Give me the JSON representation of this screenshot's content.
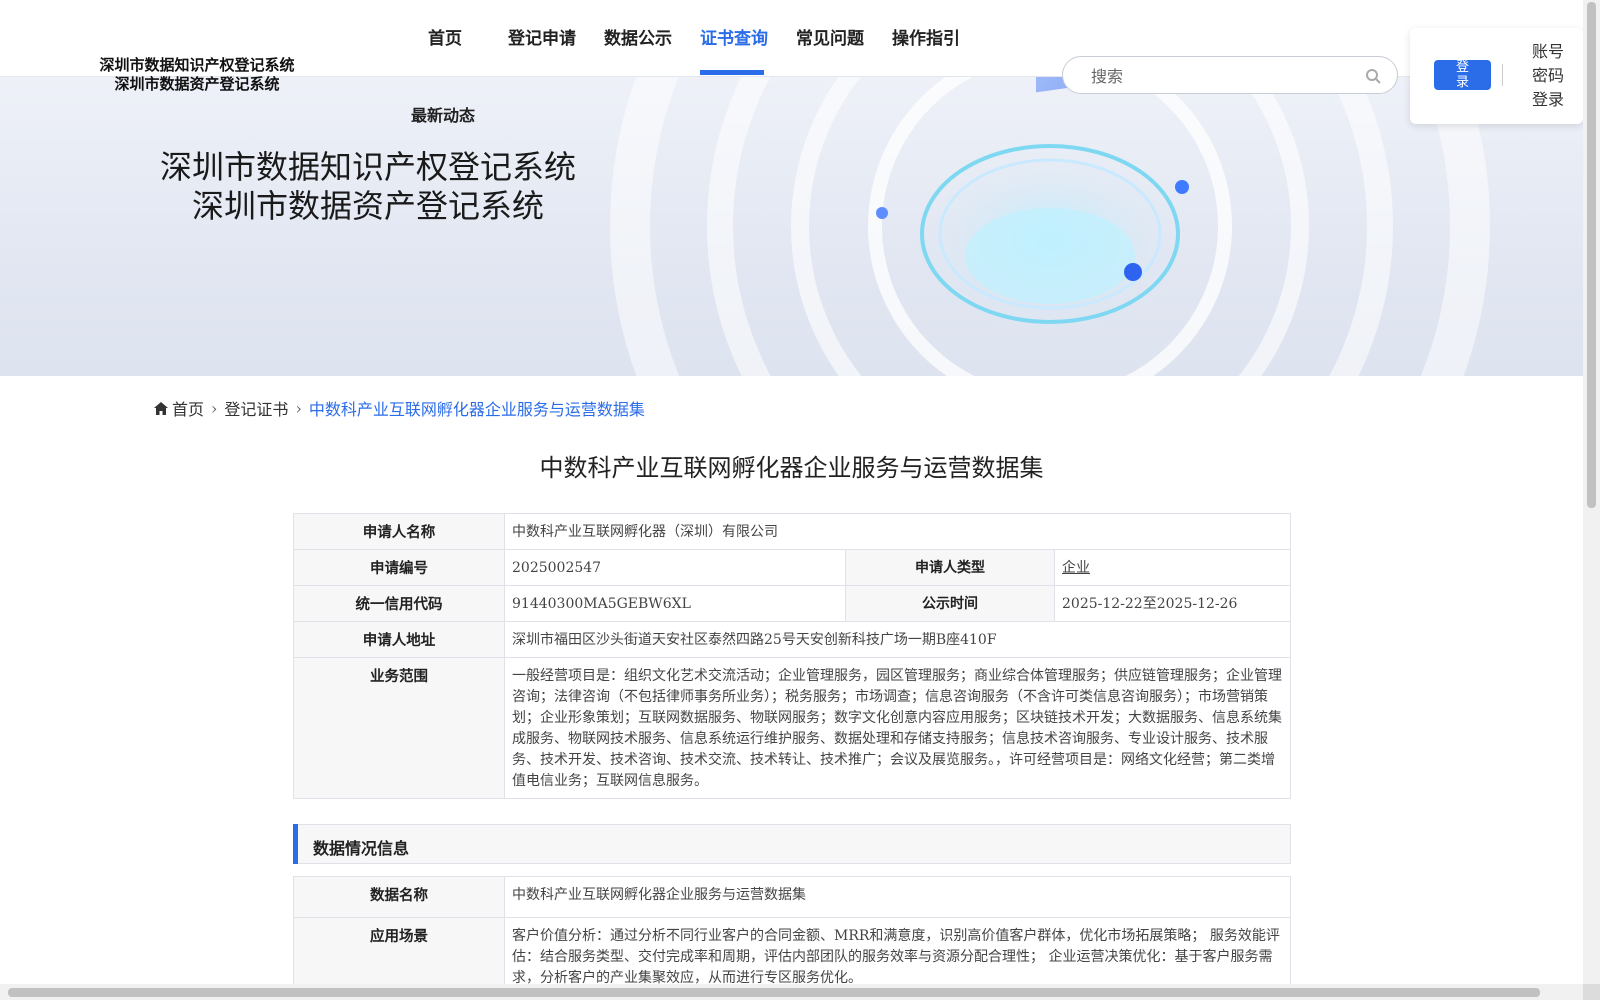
{
  "header": {
    "logo_line1": "深圳市数据知识产权登记系统",
    "logo_line2": "深圳市数据资产登记系统",
    "nav": [
      {
        "label": "首页"
      },
      {
        "label": "登记申请"
      },
      {
        "label": "数据公示"
      },
      {
        "label": "证书查询"
      },
      {
        "label": "常见问题"
      },
      {
        "label": "操作指引"
      }
    ],
    "nav_sub": "最新动态",
    "active_nav": "证书查询",
    "search_placeholder": "搜索",
    "login_button": "登录",
    "account_login": "账号密码登录"
  },
  "banner": {
    "title_line1": "深圳市数据知识产权登记系统",
    "title_line2": "深圳市数据资产登记系统"
  },
  "breadcrumb": {
    "home": "首页",
    "level2": "登记证书",
    "current": "中数科产业互联网孵化器企业服务与运营数据集"
  },
  "detail_title": "中数科产业互联网孵化器企业服务与运营数据集",
  "applicant": {
    "name_label": "申请人名称",
    "name_value": "中数科产业互联网孵化器（深圳）有限公司",
    "number_label": "申请编号",
    "number_value": "2025002547",
    "type_label": "申请人类型",
    "type_value": "企业",
    "credit_label": "统一信用代码",
    "credit_value": "91440300MA5GEBW6XL",
    "publicity_label": "公示时间",
    "publicity_value": "2025-12-22至2025-12-26",
    "address_label": "申请人地址",
    "address_value": "深圳市福田区沙头街道天安社区泰然四路25号天安创新科技广场一期B座410F",
    "scope_label": "业务范围",
    "scope_value": "一般经营项目是：组织文化艺术交流活动；企业管理服务，园区管理服务；商业综合体管理服务；供应链管理服务；企业管理咨询；法律咨询（不包括律师事务所业务）；税务服务；市场调查；信息咨询服务（不含许可类信息咨询服务）；市场营销策划；企业形象策划；互联网数据服务、物联网服务；数字文化创意内容应用服务；区块链技术开发；大数据服务、信息系统集成服务、物联网技术服务、信息系统运行维护服务、数据处理和存储支持服务；信息技术咨询服务、专业设计服务、技术服务、技术开发、技术咨询、技术交流、技术转让、技术推广；会议及展览服务。，许可经营项目是：网络文化经营；第二类增值电信业务；互联网信息服务。"
  },
  "data_section": {
    "title": "数据情况信息",
    "name_label": "数据名称",
    "name_value": "中数科产业互联网孵化器企业服务与运营数据集",
    "scenario_label": "应用场景",
    "scenario_value": "客户价值分析：通过分析不同行业客户的合同金额、MRR和满意度，识别高价值客户群体，优化市场拓展策略； 服务效能评估：结合服务类型、交付完成率和周期，评估内部团队的服务效率与资源分配合理性； 企业运营决策优化：基于客户服务需求，分析客户的产业集聚效应，从而进行专区服务优化。"
  },
  "colors": {
    "accent": "#2b6ce8",
    "label_bg": "#f7f7f8",
    "border": "#dfe2e8"
  }
}
